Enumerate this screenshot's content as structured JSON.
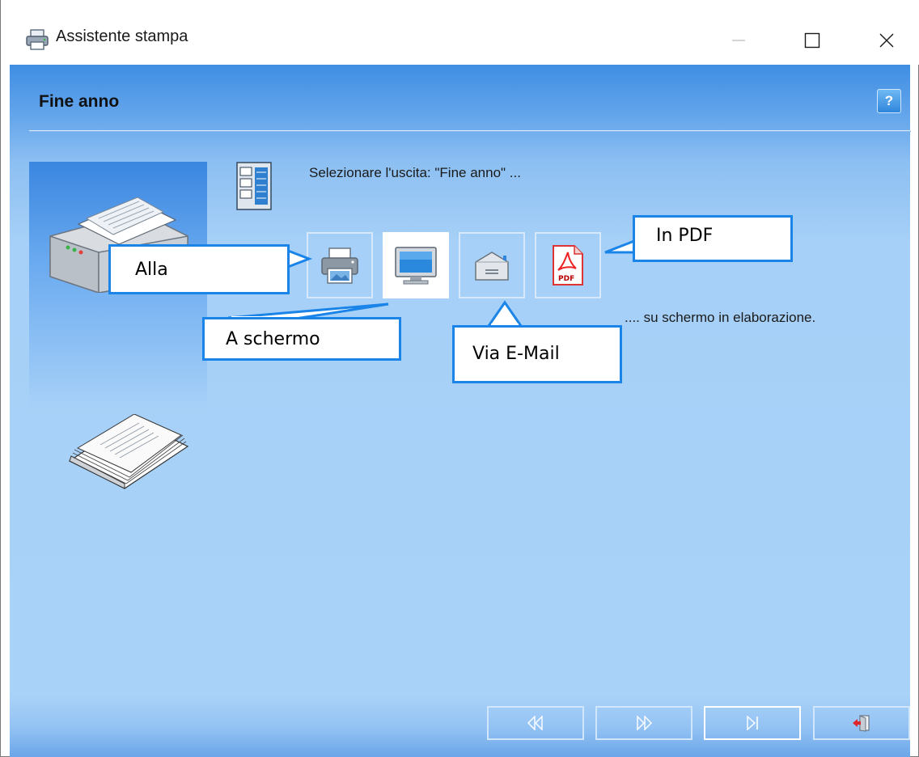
{
  "window": {
    "title": "Assistente stampa"
  },
  "header": {
    "title": "Fine anno",
    "help_label": "?"
  },
  "main": {
    "prompt": "Selezionare l'uscita: \"Fine anno\" ...",
    "status": ".... su schermo  in elaborazione.",
    "options": [
      {
        "id": "printer",
        "icon": "printer-icon",
        "selected": false
      },
      {
        "id": "screen",
        "icon": "monitor-icon",
        "selected": true
      },
      {
        "id": "email",
        "icon": "envelope-icon",
        "selected": false
      },
      {
        "id": "pdf",
        "icon": "pdf-icon",
        "selected": false
      }
    ]
  },
  "callouts": {
    "printer": "Alla",
    "screen": "A schermo",
    "email": "Via E-Mail",
    "pdf": "In PDF"
  },
  "navigation": {
    "buttons": [
      "first-icon",
      "next-icon",
      "last-icon",
      "exit-icon"
    ]
  },
  "colors": {
    "accent": "#1a84e8",
    "background": "#a9d2f8",
    "header_gradient": "#3f8ee3"
  }
}
